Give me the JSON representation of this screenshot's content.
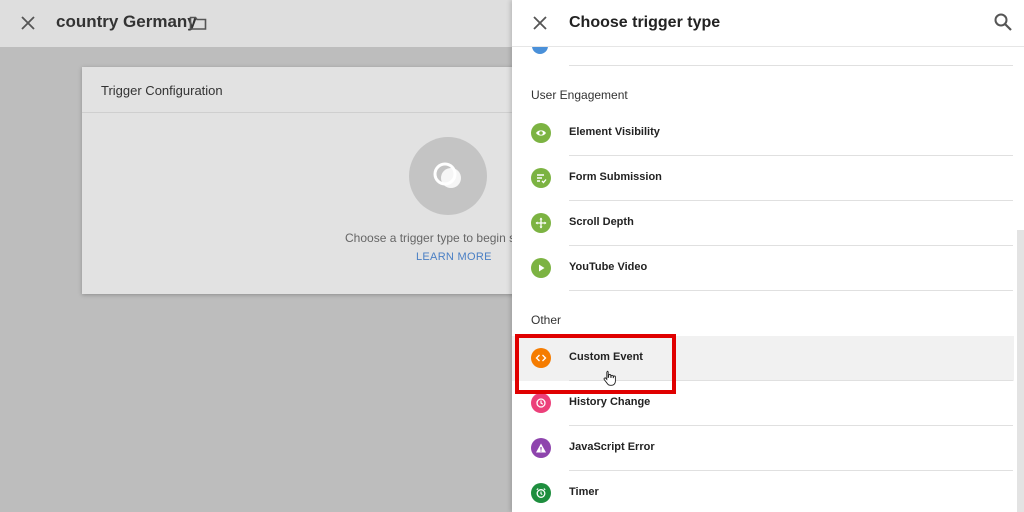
{
  "editor": {
    "title": "country Germany",
    "card": {
      "heading": "Trigger Configuration",
      "hint": "Choose a trigger type to begin s",
      "link": "LEARN MORE"
    }
  },
  "panel": {
    "title": "Choose trigger type",
    "sections": [
      {
        "label": "User Engagement",
        "items": [
          {
            "label": "Element Visibility",
            "icon": "eye-icon",
            "color": "#7cb342"
          },
          {
            "label": "Form Submission",
            "icon": "form-icon",
            "color": "#7cb342"
          },
          {
            "label": "Scroll Depth",
            "icon": "move-icon",
            "color": "#7cb342"
          },
          {
            "label": "YouTube Video",
            "icon": "play-icon",
            "color": "#7cb342"
          }
        ]
      },
      {
        "label": "Other",
        "items": [
          {
            "label": "Custom Event",
            "icon": "code-icon",
            "color": "#f57c00"
          },
          {
            "label": "History Change",
            "icon": "history-icon",
            "color": "#ec407a"
          },
          {
            "label": "JavaScript Error",
            "icon": "warning-icon",
            "color": "#8e44ad"
          },
          {
            "label": "Timer",
            "icon": "timer-icon",
            "color": "#1e8e3e"
          }
        ]
      }
    ],
    "top_stub_color": "#4a90d9"
  },
  "highlight_color": "#e00000"
}
